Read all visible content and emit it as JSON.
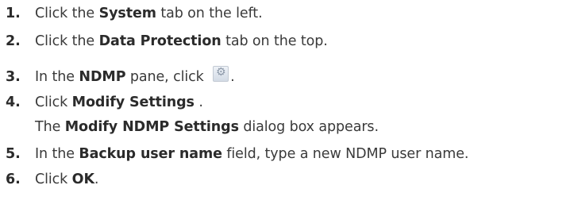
{
  "steps": [
    {
      "num": "1.",
      "pre": "Click the ",
      "bold": "System",
      "post": " tab on the left."
    },
    {
      "num": "2.",
      "pre": "Click the ",
      "bold": "Data Protection",
      "post": " tab on the top."
    },
    {
      "num": "3.",
      "pre": "In the ",
      "bold": "NDMP",
      "post": " pane, click ",
      "icon": "gear-settings-icon",
      "after_icon": "."
    },
    {
      "num": "4.",
      "pre": "Click ",
      "bold": "Modify Settings",
      "post": " ."
    },
    {
      "pre": "The ",
      "bold": "Modify NDMP Settings",
      "post": " dialog box appears."
    },
    {
      "num": "5.",
      "pre": "In the ",
      "bold": "Backup user name",
      "post": " field, type a new NDMP user name."
    },
    {
      "num": "6.",
      "pre": "Click ",
      "bold": "OK",
      "post": "."
    }
  ]
}
